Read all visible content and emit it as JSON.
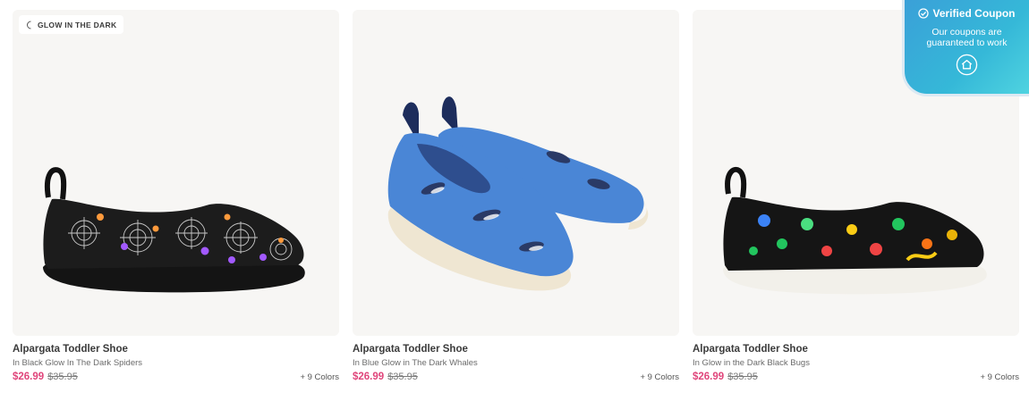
{
  "products": [
    {
      "badge": "GLOW IN THE DARK",
      "name": "Alpargata Toddler Shoe",
      "variant": "In Black Glow In The Dark Spiders",
      "sale_price": "$26.99",
      "original_price": "$35.95",
      "colors": "+ 9 Colors"
    },
    {
      "name": "Alpargata Toddler Shoe",
      "variant": "In Blue Glow in The Dark Whales",
      "sale_price": "$26.99",
      "original_price": "$35.95",
      "colors": "+ 9 Colors"
    },
    {
      "name": "Alpargata Toddler Shoe",
      "variant": "In Glow in the Dark Black Bugs",
      "sale_price": "$26.99",
      "original_price": "$35.95",
      "colors": "+ 9 Colors"
    }
  ],
  "coupon": {
    "title": "Verified Coupon",
    "subtitle": "Our coupons are guaranteed to work",
    "icon": "home-icon"
  },
  "colors": {
    "sale_price": "#e0457b",
    "card_bg": "#f7f6f4",
    "coupon_gradient_start": "#3aa0d8",
    "coupon_gradient_end": "#4fd3e0"
  }
}
